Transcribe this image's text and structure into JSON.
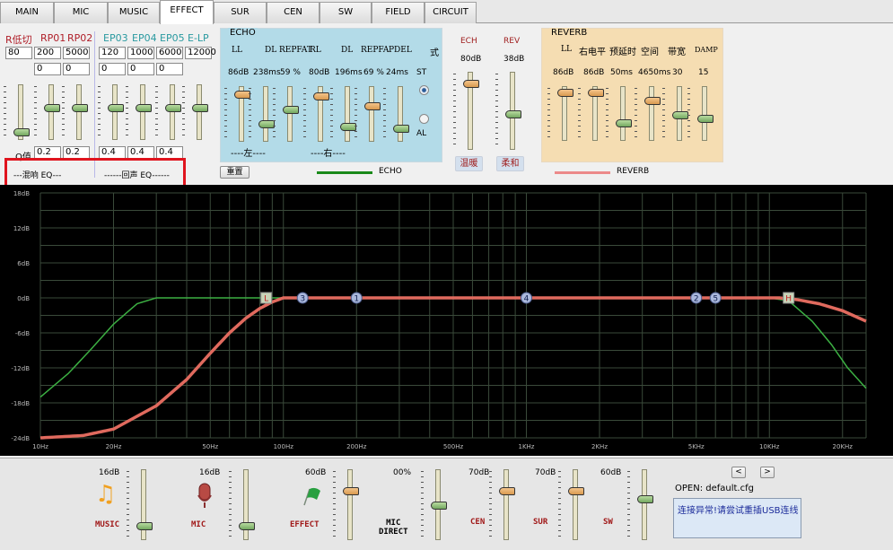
{
  "tabs": [
    "MAIN",
    "MIC",
    "MUSIC",
    "EFFECT",
    "SUR",
    "CEN",
    "SW",
    "FIELD",
    "CIRCUIT"
  ],
  "active_tab": "EFFECT",
  "eq": {
    "labels": [
      "R低切",
      "RP01",
      "RP02",
      "EP03",
      "EP04",
      "EP05",
      "E-LP"
    ],
    "freq": [
      "80",
      "200",
      "5000",
      "120",
      "1000",
      "6000",
      "12000"
    ],
    "gain": [
      "0",
      "0",
      "0",
      "0",
      "0"
    ],
    "q_label": "Q值",
    "q": [
      "0.2",
      "0.2",
      "0.4",
      "0.4",
      "0.4"
    ],
    "levels": [
      0.1,
      0.6,
      0.6,
      0.6,
      0.6,
      0.6,
      0.6
    ],
    "reverb_eq_label": "---混响 EQ---",
    "echo_eq_label": "------回声 EQ------"
  },
  "echo": {
    "title": "ECHO",
    "headers": [
      "LL",
      "DL",
      "REPFAT",
      "RL",
      "DL",
      "REPFA",
      "PDEL",
      "式"
    ],
    "values": [
      "86dB",
      "238ms",
      "59 %",
      "80dB",
      "196ms",
      "69 %",
      "24ms"
    ],
    "levels": [
      0.9,
      0.3,
      0.6,
      0.87,
      0.25,
      0.67,
      0.2
    ],
    "mode_st": "ST",
    "mode_al": "AL",
    "mode_selected": "ST",
    "left_label": "----左----",
    "right_label": "----右----",
    "reset_button": "重置",
    "legend": "ECHO"
  },
  "ech": {
    "label": "ECH",
    "value": "80dB",
    "level": 0.9,
    "button": "温暖"
  },
  "rev": {
    "label": "REV",
    "value": "38dB",
    "level": 0.45,
    "button": "柔和"
  },
  "reverb": {
    "title": "REVERB",
    "headers": [
      "LL",
      "右电平",
      "预延时",
      "空间",
      "带宽",
      "DAMP"
    ],
    "values": [
      "86dB",
      "86dB",
      "50ms",
      "4650ms",
      "30",
      "15"
    ],
    "levels": [
      0.93,
      0.93,
      0.3,
      0.77,
      0.48,
      0.4
    ],
    "legend": "REVERB"
  },
  "chart_data": {
    "type": "line",
    "x_scale": "log",
    "xlim": [
      10,
      25000
    ],
    "ylim": [
      -24,
      18
    ],
    "grid": true,
    "x_ticks": [
      "10Hz",
      "20Hz",
      "50Hz",
      "100Hz",
      "200Hz",
      "500Hz",
      "1KHz",
      "2KHz",
      "5KHz",
      "10KHz",
      "20KHz"
    ],
    "x_tick_values": [
      10,
      20,
      50,
      100,
      200,
      500,
      1000,
      2000,
      5000,
      10000,
      20000
    ],
    "y_ticks": [
      "18dB",
      "12dB",
      "6dB",
      "0dB",
      "-6dB",
      "-12dB",
      "-18dB",
      "-24dB"
    ],
    "y_tick_values": [
      18,
      12,
      6,
      0,
      -6,
      -12,
      -18,
      -24
    ],
    "series": [
      {
        "color": "#3cb043",
        "x": [
          10,
          13,
          16,
          20,
          25,
          30,
          10000,
          12000,
          15000,
          18000,
          21000,
          25000
        ],
        "y": [
          -17,
          -13,
          -9,
          -4.5,
          -1,
          0,
          0,
          -0.5,
          -4,
          -8,
          -12,
          -15.5
        ]
      },
      {
        "color": "#e06a5e",
        "x": [
          10,
          15,
          20,
          30,
          40,
          50,
          60,
          70,
          80,
          90,
          100,
          11000,
          13000,
          16000,
          20000,
          25000
        ],
        "y": [
          -24,
          -23.6,
          -22.5,
          -18.5,
          -14,
          -9.5,
          -6,
          -3.5,
          -1.8,
          -0.7,
          0,
          0,
          -0.3,
          -1,
          -2.2,
          -4
        ]
      }
    ],
    "markers": [
      {
        "label": "L",
        "x": 85,
        "shape": "square"
      },
      {
        "label": "3",
        "x": 120,
        "shape": "circle"
      },
      {
        "label": "1",
        "x": 200,
        "shape": "circle"
      },
      {
        "label": "4",
        "x": 1000,
        "shape": "circle"
      },
      {
        "label": "2",
        "x": 5000,
        "shape": "circle"
      },
      {
        "label": "5",
        "x": 6000,
        "shape": "circle"
      },
      {
        "label": "H",
        "x": 12000,
        "shape": "square"
      }
    ]
  },
  "bottom": {
    "channels": [
      {
        "label": "MUSIC",
        "value": "16dB",
        "level": 0.16,
        "icon": "music-note-icon"
      },
      {
        "label": "MIC",
        "value": "16dB",
        "level": 0.16,
        "icon": "microphone-icon"
      },
      {
        "label": "EFFECT",
        "value": "60dB",
        "level": 0.73,
        "icon": "flag-icon"
      },
      {
        "label": "MIC\nDIRECT",
        "value": "00%",
        "level": 0.5
      },
      {
        "label": "CEN",
        "value": "70dB",
        "level": 0.73
      },
      {
        "label": "SUR",
        "value": "70dB",
        "level": 0.73
      },
      {
        "label": "SW",
        "value": "60dB",
        "level": 0.6
      }
    ],
    "prev_button": "<",
    "next_button": ">",
    "open_label": "OPEN:  default.cfg",
    "status": "连接异常!请尝试重插USB连线"
  }
}
